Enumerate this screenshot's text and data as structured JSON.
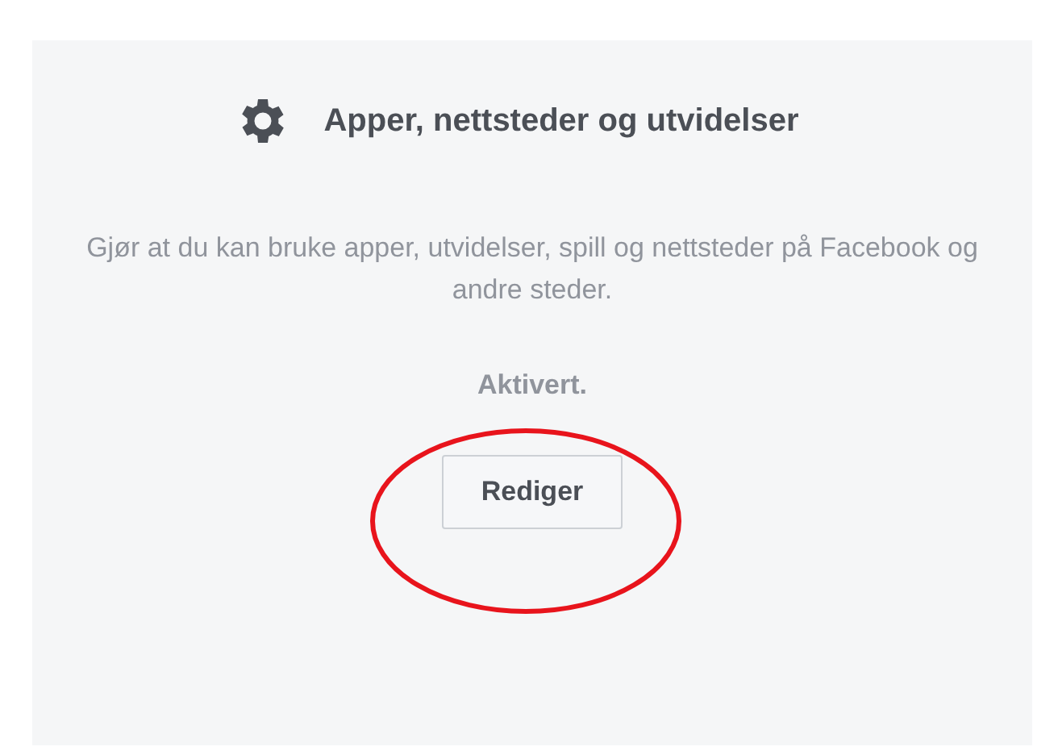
{
  "section": {
    "title": "Apper, nettsteder og utvidelser",
    "description": "Gjør at du kan bruke apper, utvidelser, spill og nettsteder på Facebook og andre steder.",
    "status": "Aktivert.",
    "button": "Rediger"
  },
  "annotation": {
    "kind": "ellipse"
  }
}
